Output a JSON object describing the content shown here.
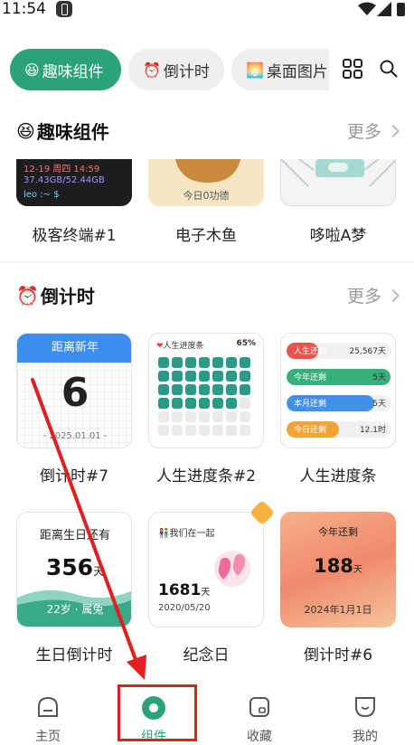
{
  "status": {
    "time": "11:54"
  },
  "tabs": [
    {
      "label": "趣味组件",
      "emoji": "😆",
      "active": true
    },
    {
      "label": "倒计时",
      "emoji": "⏰",
      "active": false
    },
    {
      "label": "桌面图片",
      "emoji": "🌅",
      "active": false
    }
  ],
  "sections": {
    "fun": {
      "title": "趣味组件",
      "emoji": "😆",
      "more": "更多",
      "items": [
        {
          "label": "极客终端#1",
          "lines": [
            "12-19 周四 14:59",
            "37.43GB/52.44GB",
            "leo :~ $"
          ]
        },
        {
          "label": "电子木鱼",
          "caption": "今日0功德"
        },
        {
          "label": "哆啦A梦"
        }
      ]
    },
    "countdown": {
      "title": "倒计时",
      "emoji": "⏰",
      "more": "更多",
      "items": [
        {
          "label": "倒计时#7",
          "header": "距离新年",
          "number": "6",
          "date": "- 2025.01.01 -"
        },
        {
          "label": "人生进度条#2",
          "title": "人生进度条",
          "percent": "65%",
          "filled_fraction": 0.65
        },
        {
          "label": "人生进度条",
          "bars": [
            {
              "name": "人生还剩",
              "value": "25,567天",
              "color": "#e8433b",
              "fraction": 0.3
            },
            {
              "name": "今年还剩",
              "value": "5天",
              "color": "#22a86e",
              "fraction": 0.99
            },
            {
              "name": "本月还剩",
              "value": "5天",
              "color": "#2f86e8",
              "fraction": 0.84
            },
            {
              "name": "今日还剩",
              "value": "12.1时",
              "color": "#f29a1f",
              "fraction": 0.5
            }
          ]
        },
        {
          "label": "生日倒计时",
          "title": "距离生日还有",
          "number": "356",
          "unit": "天",
          "footer": "22岁 · 属兔"
        },
        {
          "label": "纪念日",
          "title": "我们在一起",
          "number": "1681",
          "unit": "天",
          "date": "2020/05/20"
        },
        {
          "label": "倒计时#6",
          "title": "今年还剩",
          "number": "188",
          "unit": "天",
          "date": "2024年1月1日"
        }
      ]
    }
  },
  "nav": [
    {
      "label": "主页",
      "active": false
    },
    {
      "label": "组件",
      "active": true
    },
    {
      "label": "收藏",
      "active": false
    },
    {
      "label": "我的",
      "active": false
    }
  ],
  "colors": {
    "accent": "#2ba27a",
    "highlight": "#e02020"
  }
}
